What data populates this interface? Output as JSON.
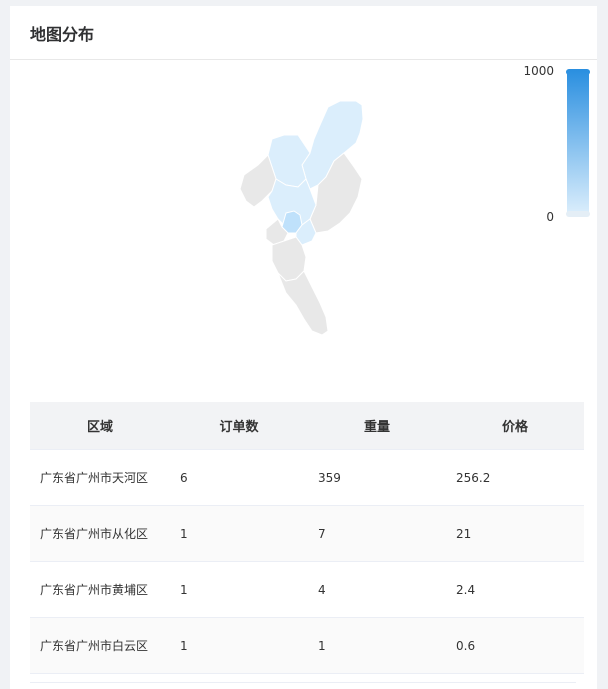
{
  "card": {
    "title": "地图分布"
  },
  "visual_map": {
    "max_label": "1000",
    "min_label": "0",
    "colors": [
      "#2a8fe0",
      "#dbeefc"
    ]
  },
  "map": {
    "highlight_color": "#bfe1fb",
    "light_color": "#dbeefc",
    "gray_color": "#e8e8e8"
  },
  "table": {
    "headers": [
      "区域",
      "订单数",
      "重量",
      "价格"
    ],
    "rows": [
      [
        "广东省广州市天河区",
        "6",
        "359",
        "256.2"
      ],
      [
        "广东省广州市从化区",
        "1",
        "7",
        "21"
      ],
      [
        "广东省广州市黄埔区",
        "1",
        "4",
        "2.4"
      ],
      [
        "广东省广州市白云区",
        "1",
        "1",
        "0.6"
      ]
    ]
  }
}
